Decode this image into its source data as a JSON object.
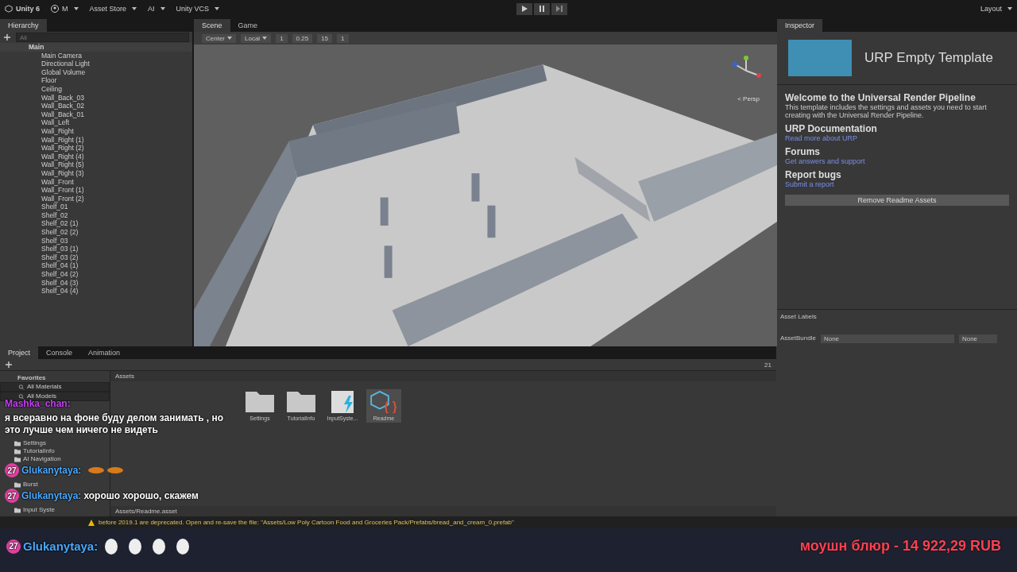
{
  "toolbar": {
    "app_title": "Unity 6",
    "account": "M",
    "asset_store": "Asset Store",
    "ai": "AI",
    "vcs": "Unity VCS",
    "layout": "Layout"
  },
  "hierarchy": {
    "tab": "Hierarchy",
    "search_placeholder": "All",
    "scene": "Main",
    "items": [
      "Main Camera",
      "Directional Light",
      "Global Volume",
      "Floor",
      "Ceiling",
      "Wall_Back_03",
      "Wall_Back_02",
      "Wall_Back_01",
      "Wall_Left",
      "Wall_Right",
      "Wall_Right (1)",
      "Wall_Right (2)",
      "Wall_Right (4)",
      "Wall_Right (5)",
      "Wall_Right (3)",
      "Wall_Front",
      "Wall_Front (1)",
      "Wall_Front (2)",
      "Shelf_01",
      "Shelf_02",
      "Shelf_02 (1)",
      "Shelf_02 (2)",
      "Shelf_03",
      "Shelf_03 (1)",
      "Shelf_03 (2)",
      "Shelf_04 (1)",
      "Shelf_04 (2)",
      "Shelf_04 (3)",
      "Shelf_04 (4)"
    ]
  },
  "scene_view": {
    "tabs": [
      {
        "label": "Scene",
        "selected": true
      },
      {
        "label": "Game",
        "selected": false
      }
    ],
    "pivot": "Center",
    "space": "Local",
    "grid_size": "1",
    "move_snap": "0.25",
    "rotate_snap": "15",
    "scale_snap": "1",
    "projection": "< Persp"
  },
  "inspector": {
    "tab": "Inspector",
    "title": "URP Empty Template",
    "sections": [
      {
        "heading": "Welcome to the Universal Render Pipeline",
        "kind": "text",
        "body": "This template includes the settings and assets you need to start creating with the Universal Render Pipeline."
      },
      {
        "heading": "URP Documentation",
        "kind": "link",
        "body": "Read more about URP"
      },
      {
        "heading": "Forums",
        "kind": "link",
        "body": "Get answers and support"
      },
      {
        "heading": "Report bugs",
        "kind": "link",
        "body": "Submit a report"
      }
    ],
    "button": "Remove Readme Assets",
    "asset_labels": "Asset Labels",
    "asset_bundle": {
      "label": "AssetBundle",
      "value": "None",
      "variant": "None"
    }
  },
  "project": {
    "tabs": [
      {
        "label": "Project",
        "selected": true
      },
      {
        "label": "Console",
        "selected": false
      },
      {
        "label": "Animation",
        "selected": false
      }
    ],
    "tree": [
      {
        "label": "Favorites",
        "kind": "header"
      },
      {
        "label": "All Materials",
        "kind": "search"
      },
      {
        "label": "All Models",
        "kind": "search"
      },
      {
        "label": "Settings",
        "kind": "folder"
      },
      {
        "label": "TutorialInfo",
        "kind": "folder"
      },
      {
        "label": "AI Navigation",
        "kind": "folder"
      },
      {
        "label": "Burst",
        "kind": "folder"
      },
      {
        "label": "Input Syste",
        "kind": "folder"
      }
    ],
    "breadcrumb": "Assets",
    "count": "21",
    "assets": [
      {
        "label": "Settings",
        "kind": "folder",
        "selected": false
      },
      {
        "label": "TutorialInfo",
        "kind": "folder",
        "selected": false
      },
      {
        "label": "InputSyste...",
        "kind": "input",
        "selected": false
      },
      {
        "label": "Readme",
        "kind": "readme",
        "selected": true
      }
    ],
    "path": "Assets/Readme.asset"
  },
  "status": "before 2019.1 are deprecated. Open and re-save the file: \"Assets/Low Poly Cartoon Food and Groceries Pack/Prefabs/bread_and_cream_0.prefab\"",
  "chat": [
    {
      "user": "Mashka_chan:",
      "color": "#c040f0",
      "kind": "text",
      "text": "я всеравно на фоне буду делом занимать , но это лучше чем ничего не видеть"
    },
    {
      "user": "Glukanytaya:",
      "color": "#4aa8ff",
      "badge": "27",
      "kind": "emotes"
    },
    {
      "user": "Glukanytaya:",
      "color": "#4aa8ff",
      "badge": "27",
      "kind": "text",
      "text": "хорошо хорошо, скажем"
    }
  ],
  "last_chat": {
    "user": "Glukanytaya:",
    "color": "#4aa8ff",
    "badge": "27",
    "kind": "emotes"
  },
  "donation": "моушн блюр - 14 922,29 RUB"
}
